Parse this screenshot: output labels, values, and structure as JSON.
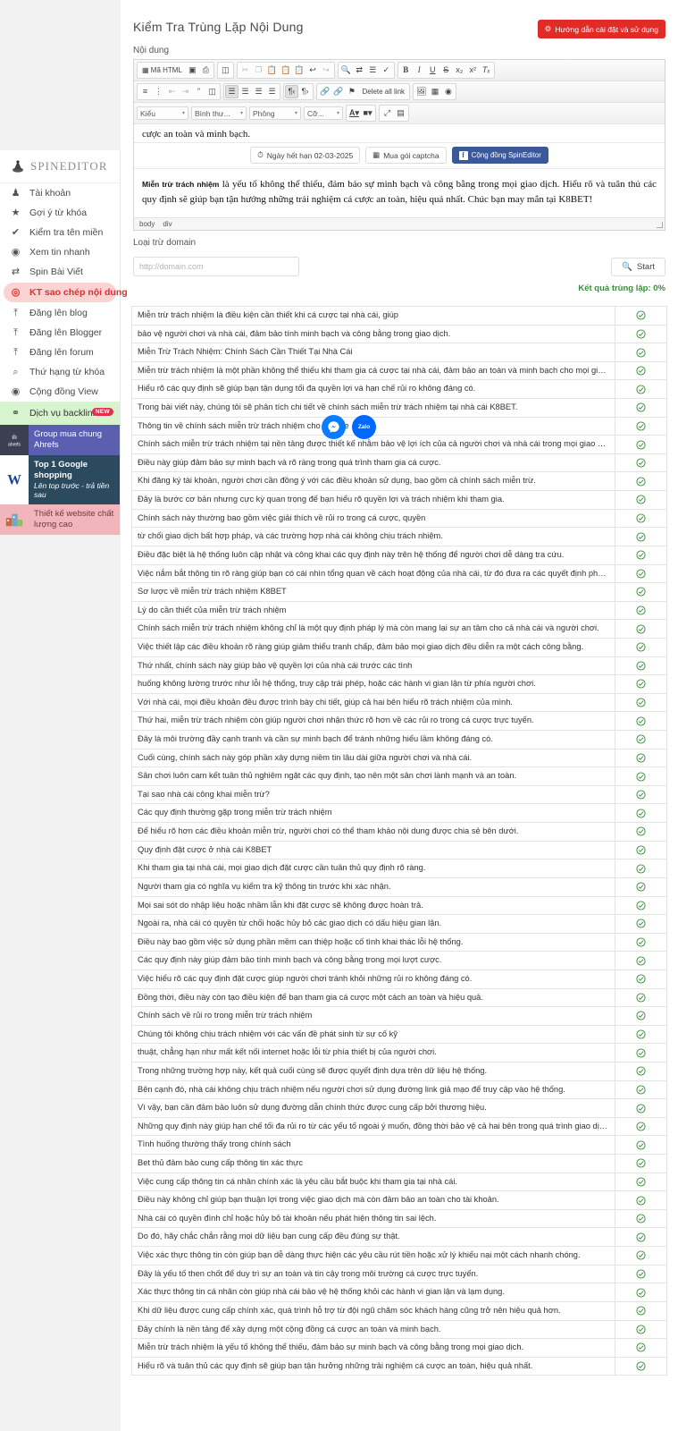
{
  "app": {
    "brand": "SPINEDITOR"
  },
  "sidebar": {
    "items": [
      {
        "label": "Tài khoản",
        "icon": "user-icon",
        "glyph": "♟"
      },
      {
        "label": "Gợi ý từ khóa",
        "icon": "star-icon",
        "glyph": "★"
      },
      {
        "label": "Kiểm tra tên miền",
        "icon": "check-icon",
        "glyph": "✔"
      },
      {
        "label": "Xem tin nhanh",
        "icon": "eye-icon",
        "glyph": "◉"
      },
      {
        "label": "Spin Bài Viết",
        "icon": "shuffle-icon",
        "glyph": "⇄"
      },
      {
        "label": "KT sao chép nội dung",
        "icon": "target-icon",
        "glyph": "◎"
      },
      {
        "label": "Đăng lên blog",
        "icon": "upload-icon",
        "glyph": "⤒"
      },
      {
        "label": "Đăng lên Blogger",
        "icon": "upload-icon",
        "glyph": "⤒"
      },
      {
        "label": "Đăng lên forum",
        "icon": "upload-icon",
        "glyph": "⤒"
      },
      {
        "label": "Thứ hạng từ khóa",
        "icon": "search-icon",
        "glyph": "⌕"
      },
      {
        "label": "Cộng đồng View",
        "icon": "eye-icon",
        "glyph": "◉"
      }
    ],
    "active_index": 5,
    "backlink": {
      "label": "Dịch vụ backlink",
      "icon": "link-icon",
      "glyph": "⚭",
      "badge": "NEW"
    },
    "promos": [
      {
        "title": "Group mua chung Ahrefs",
        "subtitle": "",
        "thumb_label": "ahrefs"
      },
      {
        "title": "Top 1 Google shopping",
        "subtitle": "Lên top trước - trả tiền sau",
        "thumb_label": "W"
      },
      {
        "title": "Thiết kế website chất lượng cao",
        "subtitle": "",
        "thumb_label": ""
      }
    ]
  },
  "header": {
    "title": "Kiểm Tra Trùng Lặp Nội Dung",
    "guide_button": "Hướng dẫn cài đặt và sử dụng",
    "guide_icon": "gear-icon"
  },
  "content_field": {
    "label": "Nội dung"
  },
  "editor": {
    "toolbar_row1": [
      {
        "label": "Mã HTML",
        "icon": "source-icon",
        "state": "normal"
      },
      {
        "label": "",
        "icon": "preview-icon",
        "state": "normal"
      },
      {
        "label": "",
        "icon": "print-icon",
        "state": "normal"
      },
      {
        "label": "",
        "icon": "templates-icon",
        "state": "normal"
      },
      {
        "label": "",
        "icon": "cut-icon",
        "state": "disabled"
      },
      {
        "label": "",
        "icon": "copy-icon",
        "state": "disabled"
      },
      {
        "label": "",
        "icon": "paste-icon",
        "state": "normal"
      },
      {
        "label": "",
        "icon": "paste-text-icon",
        "state": "normal"
      },
      {
        "label": "",
        "icon": "paste-word-icon",
        "state": "normal"
      },
      {
        "label": "",
        "icon": "undo-icon",
        "state": "normal"
      },
      {
        "label": "",
        "icon": "redo-icon",
        "state": "disabled"
      },
      {
        "label": "",
        "icon": "find-icon",
        "state": "normal"
      },
      {
        "label": "",
        "icon": "replace-icon",
        "state": "normal"
      },
      {
        "label": "",
        "icon": "select-all-icon",
        "state": "normal"
      },
      {
        "label": "",
        "icon": "spellcheck-icon",
        "state": "normal"
      },
      {
        "label": "B",
        "icon": "bold-icon",
        "state": "normal"
      },
      {
        "label": "I",
        "icon": "italic-icon",
        "state": "normal"
      },
      {
        "label": "U",
        "icon": "underline-icon",
        "state": "normal"
      },
      {
        "label": "S",
        "icon": "strike-icon",
        "state": "normal"
      },
      {
        "label": "x₂",
        "icon": "subscript-icon",
        "state": "normal"
      },
      {
        "label": "x²",
        "icon": "superscript-icon",
        "state": "normal"
      },
      {
        "label": "Tx",
        "icon": "remove-format-icon",
        "state": "normal"
      }
    ],
    "toolbar_row2": [
      {
        "label": "",
        "icon": "numbered-list-icon",
        "state": "normal"
      },
      {
        "label": "",
        "icon": "bulleted-list-icon",
        "state": "normal"
      },
      {
        "label": "",
        "icon": "outdent-icon",
        "state": "disabled"
      },
      {
        "label": "",
        "icon": "indent-icon",
        "state": "disabled"
      },
      {
        "label": "”",
        "icon": "blockquote-icon",
        "state": "normal"
      },
      {
        "label": "",
        "icon": "div-container-icon",
        "state": "normal"
      },
      {
        "label": "",
        "icon": "align-left-icon",
        "state": "on"
      },
      {
        "label": "",
        "icon": "align-center-icon",
        "state": "normal"
      },
      {
        "label": "",
        "icon": "align-right-icon",
        "state": "normal"
      },
      {
        "label": "",
        "icon": "align-justify-icon",
        "state": "normal"
      },
      {
        "label": "",
        "icon": "ltr-icon",
        "state": "on"
      },
      {
        "label": "",
        "icon": "rtl-icon",
        "state": "normal"
      },
      {
        "label": "",
        "icon": "link-icon",
        "state": "normal"
      },
      {
        "label": "",
        "icon": "unlink-icon",
        "state": "disabled"
      },
      {
        "label": "",
        "icon": "anchor-icon",
        "state": "normal"
      },
      {
        "label": "Delete all link",
        "icon": "delete-all-link-icon",
        "state": "normal"
      },
      {
        "label": "",
        "icon": "image-icon",
        "state": "normal"
      },
      {
        "label": "",
        "icon": "table-icon",
        "state": "normal"
      },
      {
        "label": "",
        "icon": "iframe-icon",
        "state": "normal"
      }
    ],
    "toolbar_row3_selects": [
      {
        "label": "Kiểu",
        "name": "styles-select"
      },
      {
        "label": "Bình thư...",
        "name": "format-select"
      },
      {
        "label": "Phông",
        "name": "font-select"
      },
      {
        "label": "Cỡ...",
        "name": "fontsize-select"
      }
    ],
    "toolbar_row3_buttons": [
      {
        "label": "A",
        "icon": "text-color-icon"
      },
      {
        "label": "A",
        "icon": "background-color-icon"
      },
      {
        "label": "",
        "icon": "maximize-icon"
      },
      {
        "label": "",
        "icon": "show-blocks-icon"
      }
    ],
    "body_top_line": "cược an toàn và minh bạch.",
    "strip_buttons": [
      {
        "label": "Ngày hết hạn 02-03-2025",
        "icon": "clock-icon"
      },
      {
        "label": "Mua gói captcha",
        "icon": "qr-icon"
      },
      {
        "label": "Cộng đồng SpinEditor",
        "icon": "facebook-icon"
      }
    ],
    "paragraph_lead": "Miễn trừ trách nhiệm",
    "paragraph_rest": " là yếu tố không thể thiếu, đảm bảo sự minh bạch và công bằng trong mọi giao dịch. Hiểu rõ và tuân thủ các quy định sẽ giúp bạn tận hưởng những trải nghiệm cá cược an toàn, hiệu quả nhất. Chúc bạn may mắn tại K8BET!",
    "path": [
      "body",
      "div"
    ]
  },
  "domain_exclusion": {
    "label": "Loại trừ domain",
    "placeholder": "http://domain.com",
    "value": "",
    "start_label": "Start",
    "start_icon": "search-icon"
  },
  "result_summary": {
    "text": "Kết quả trùng lặp: 0%",
    "color": "#3d8b3d"
  },
  "floating": [
    {
      "name": "messenger-chat-button",
      "icon": "messenger-icon",
      "label": ""
    },
    {
      "name": "zalo-chat-button",
      "icon": "zalo-icon",
      "label": "Zalo"
    }
  ],
  "results": {
    "status_icon": "check-circle-icon",
    "status_color": "#2f8f2f",
    "rows": [
      "Miễn trừ trách nhiệm là điều kiện cần thiết khi cá cược tại nhà cái, giúp",
      "bảo vệ người chơi và nhà cái, đảm bảo tính minh bạch và công bằng trong giao dịch.",
      "Miễn Trừ Trách Nhiệm: Chính Sách Cần Thiết Tại Nhà Cái",
      "Miễn trừ trách nhiệm là một phần không thể thiếu khi tham gia cá cược tại nhà cái, đảm bảo an toàn và minh bạch cho mọi giao dịch.",
      "Hiểu rõ các quy định sẽ giúp bạn tận dụng tối đa quyền lợi và hạn chế rủi ro không đáng có.",
      "Trong bài viết này, chúng tôi sẽ phân tích chi tiết về chính sách miễn trừ trách nhiệm tại nhà cái K8BET.",
      "Thông tin về chính sách miễn trừ trách nhiệm cho newbie",
      "Chính sách miễn trừ trách nhiệm tại nền tảng được thiết kế nhằm bảo vệ lợi ích của cả người chơi và nhà cái trong mọi giao dịch.",
      "Điều này giúp đảm bảo sự minh bạch và rõ ràng trong quá trình tham gia cá cược.",
      "Khi đăng ký tài khoản, người chơi cần đồng ý với các điều khoản sử dụng, bao gồm cả chính sách miễn trừ.",
      "Đây là bước cơ bản nhưng cực kỳ quan trọng để bạn hiểu rõ quyền lợi và trách nhiệm khi tham gia.",
      "Chính sách này thường bao gồm việc giải thích về rủi ro trong cá cược, quyền",
      "từ chối giao dịch bất hợp pháp, và các trường hợp nhà cái không chịu trách nhiệm.",
      "Điều đặc biệt là hệ thống luôn cập nhật và công khai các quy định này trên hệ thống để người chơi dễ dàng tra cứu.",
      "Việc nắm bắt thông tin rõ ràng giúp bạn có cái nhìn tổng quan về cách hoạt động của nhà cái, từ đó đưa ra các quyết định phù hợp.",
      "Sơ lược về miễn trừ trách nhiệm K8BET",
      "Lý do cần thiết của miễn trừ trách nhiệm",
      "Chính sách miễn trừ trách nhiệm không chỉ là một quy định pháp lý mà còn mang lại sự an tâm cho cả nhà cái và người chơi.",
      "Việc thiết lập các điều khoản rõ ràng giúp giảm thiểu tranh chấp, đảm bảo mọi giao dịch đều diễn ra một cách công bằng.",
      "Thứ nhất, chính sách này giúp bảo vệ quyền lợi của nhà cái trước các tình",
      "huống không lường trước như lỗi hệ thống, truy cập trái phép, hoặc các hành vi gian lận từ phía người chơi.",
      "Với nhà cái, mọi điều khoản đều được trình bày chi tiết, giúp cả hai bên hiểu rõ trách nhiệm của mình.",
      "Thứ hai, miễn trừ trách nhiệm còn giúp người chơi nhận thức rõ hơn về các rủi ro trong cá cược trực tuyến.",
      "Đây là môi trường đầy cạnh tranh và cần sự minh bạch để tránh những hiểu lầm không đáng có.",
      "Cuối cùng, chính sách này góp phần xây dựng niềm tin lâu dài giữa người chơi và nhà cái.",
      "Sân chơi luôn cam kết tuân thủ nghiêm ngặt các quy định, tạo nên một sân chơi lành mạnh và an toàn.",
      "Tại sao nhà cái công khai miễn trừ?",
      "Các quy định thường gặp trong miễn trừ trách nhiệm",
      "Để hiểu rõ hơn các điều khoản miễn trừ, người chơi có thể tham khảo nội dung được chia sẻ bên dưới.",
      "Quy định đặt cược ở nhà cái K8BET",
      "Khi tham gia tại nhà cái, mọi giao dịch đặt cược cần tuân thủ quy định rõ ràng.",
      "Người tham gia có nghĩa vụ kiểm tra kỹ thông tin trước khi xác nhận.",
      "Mọi sai sót do nhập liệu hoặc nhầm lẫn khi đặt cược sẽ không được hoàn trả.",
      "Ngoài ra, nhà cái có quyền từ chối hoặc hủy bỏ các giao dịch có dấu hiệu gian lận.",
      "Điều này bao gồm việc sử dụng phần mềm can thiệp hoặc cố tình khai thác lỗi hệ thống.",
      "Các quy định này giúp đảm bảo tính minh bạch và công bằng trong mọi lượt cược.",
      "Việc hiểu rõ các quy định đặt cược giúp người chơi tránh khỏi những rủi ro không đáng có.",
      "Đồng thời, điều này còn tạo điều kiện để bạn tham gia cá cược một cách an toàn và hiệu quả.",
      "Chính sách về rủi ro trong miễn trừ trách nhiệm",
      "Chúng tôi không chịu trách nhiệm với các vấn đề phát sinh từ sự cố kỹ",
      "thuật, chẳng hạn như mất kết nối internet hoặc lỗi từ phía thiết bị của người chơi.",
      "Trong những trường hợp này, kết quả cuối cùng sẽ được quyết định dựa trên dữ liệu hệ thống.",
      "Bên cạnh đó, nhà cái không chịu trách nhiệm nếu người chơi sử dụng đường link giả mạo để truy cập vào hệ thống.",
      "Vì vậy, bạn cần đảm bảo luôn sử dụng đường dẫn chính thức được cung cấp bởi thương hiệu.",
      "Những quy định này giúp hạn chế tối đa rủi ro từ các yếu tố ngoài ý muốn, đồng thời bảo vệ cả hai bên trong quá trình giao dịch.",
      "Tình huống thường thấy trong chính sách",
      "Bet thủ đảm bảo cung cấp thông tin xác thực",
      "Việc cung cấp thông tin cá nhân chính xác là yêu cầu bắt buộc khi tham gia tại nhà cái.",
      "Điều này không chỉ giúp bạn thuận lợi trong việc giao dịch mà còn đảm bảo an toàn cho tài khoản.",
      "Nhà cái có quyền đình chỉ hoặc hủy bỏ tài khoản nếu phát hiện thông tin sai lệch.",
      "Do đó, hãy chắc chắn rằng mọi dữ liệu bạn cung cấp đều đúng sự thật.",
      "Việc xác thực thông tin còn giúp bạn dễ dàng thực hiện các yêu cầu rút tiền hoặc xử lý khiếu nại một cách nhanh chóng.",
      "Đây là yếu tố then chốt để duy trì sự an toàn và tin cậy trong môi trường cá cược trực tuyến.",
      "Xác thực thông tin cá nhân còn giúp nhà cái bảo vệ hệ thống khỏi các hành vi gian lận và lạm dụng.",
      "Khi dữ liệu được cung cấp chính xác, quá trình hỗ trợ từ đội ngũ chăm sóc khách hàng cũng trở nên hiệu quả hơn.",
      "Đây chính là nền tảng để xây dựng một cộng đồng cá cược an toàn và minh bạch.",
      "Miễn trừ trách nhiệm là yếu tố không thể thiếu, đảm bảo sự minh bạch và công bằng trong mọi giao dịch.",
      "Hiểu rõ và tuân thủ các quy định sẽ giúp bạn tận hưởng những trải nghiệm cá cược an toàn, hiệu quả nhất."
    ]
  }
}
